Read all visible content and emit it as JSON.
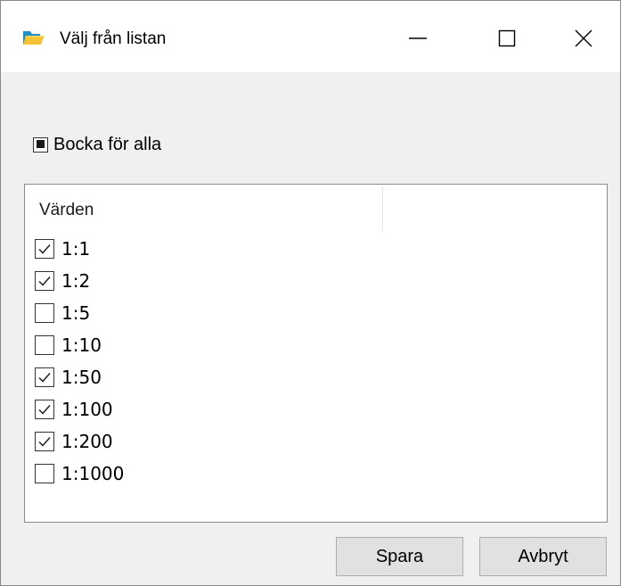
{
  "window": {
    "title": "Välj från listan",
    "icon": "folder-open-icon",
    "controls": [
      "minimize-icon",
      "maximize-icon",
      "close-icon"
    ]
  },
  "select_all": {
    "label": "Bocka för alla",
    "state": "indeterminate"
  },
  "list": {
    "column_header": "Värden",
    "items": [
      {
        "label": "1:1",
        "checked": true
      },
      {
        "label": "1:2",
        "checked": true
      },
      {
        "label": "1:5",
        "checked": false
      },
      {
        "label": "1:10",
        "checked": false
      },
      {
        "label": "1:50",
        "checked": true
      },
      {
        "label": "1:100",
        "checked": true
      },
      {
        "label": "1:200",
        "checked": true
      },
      {
        "label": "1:1000",
        "checked": false
      }
    ]
  },
  "buttons": {
    "save": "Spara",
    "cancel": "Avbryt"
  }
}
